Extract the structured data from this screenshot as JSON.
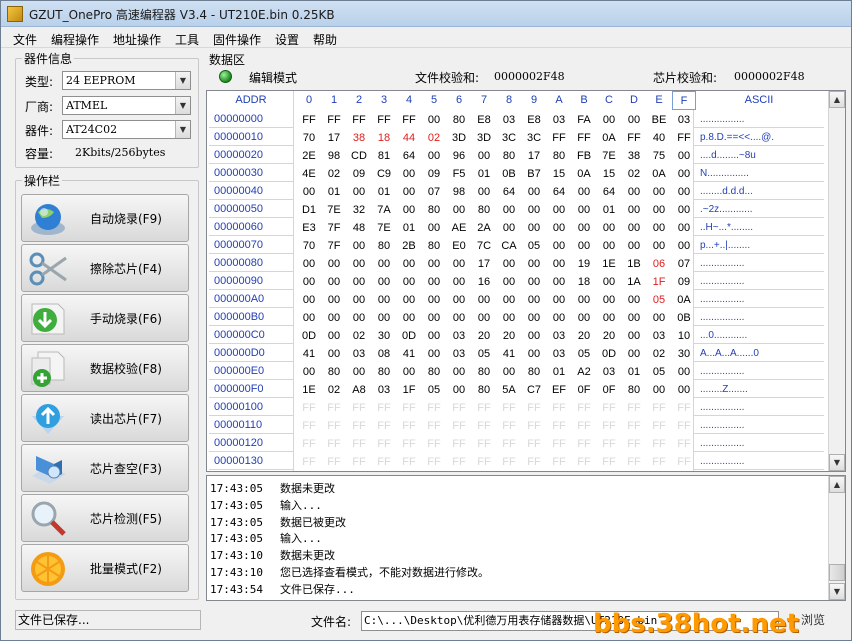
{
  "window": {
    "title": "GZUT_OnePro 高速编程器 V3.4 - UT210E.bin  0.25KB"
  },
  "menu": [
    {
      "label": "文件",
      "name": "menu-file"
    },
    {
      "label": "编程操作",
      "name": "menu-program"
    },
    {
      "label": "地址操作",
      "name": "menu-address"
    },
    {
      "label": "工具",
      "name": "menu-tools"
    },
    {
      "label": "固件操作",
      "name": "menu-firmware"
    },
    {
      "label": "设置",
      "name": "menu-settings"
    },
    {
      "label": "帮助",
      "name": "menu-help"
    }
  ],
  "device": {
    "group_title": "器件信息",
    "type_label": "类型:",
    "type_value": "24 EEPROM",
    "vendor_label": "厂商:",
    "vendor_value": "ATMEL",
    "chip_label": "器件:",
    "chip_value": "AT24C02",
    "capacity_label": "容量:",
    "capacity_value": "2Kbits/256bytes"
  },
  "operations": {
    "group_title": "操作栏",
    "buttons": [
      {
        "label": "自动烧录(F9)",
        "icon": "globe-icon"
      },
      {
        "label": "擦除芯片(F4)",
        "icon": "scissors-icon"
      },
      {
        "label": "手动烧录(F6)",
        "icon": "download-arrow-icon"
      },
      {
        "label": "数据校验(F8)",
        "icon": "verify-plus-icon"
      },
      {
        "label": "读出芯片(F7)",
        "icon": "upload-arrow-icon"
      },
      {
        "label": "芯片查空(F3)",
        "icon": "check-blank-icon"
      },
      {
        "label": "芯片检测(F5)",
        "icon": "magnifier-icon"
      },
      {
        "label": "批量模式(F2)",
        "icon": "orange-icon"
      }
    ]
  },
  "data_area": {
    "title": "数据区",
    "mode": "编辑模式",
    "file_checksum_label": "文件校验和:",
    "file_checksum": "0000002F48",
    "chip_checksum_label": "芯片校验和:",
    "chip_checksum": "0000002F48"
  },
  "hex": {
    "addr_header": "ADDR",
    "col_headers": [
      "0",
      "1",
      "2",
      "3",
      "4",
      "5",
      "6",
      "7",
      "8",
      "9",
      "A",
      "B",
      "C",
      "D",
      "E",
      "F"
    ],
    "ascii_header": "ASCII",
    "highlight_color": "#e02020",
    "rows": [
      {
        "addr": "00000000",
        "bytes": [
          "FF",
          "FF",
          "FF",
          "FF",
          "FF",
          "00",
          "80",
          "E8",
          "03",
          "E8",
          "03",
          "FA",
          "00",
          "00",
          "BE",
          "03"
        ],
        "red": [],
        "ascii": "................"
      },
      {
        "addr": "00000010",
        "bytes": [
          "70",
          "17",
          "38",
          "18",
          "44",
          "02",
          "3D",
          "3D",
          "3C",
          "3C",
          "FF",
          "FF",
          "0A",
          "FF",
          "40",
          "FF"
        ],
        "red": [
          2,
          3,
          4,
          5
        ],
        "ascii": "p.8.D.==<<....@."
      },
      {
        "addr": "00000020",
        "bytes": [
          "2E",
          "98",
          "CD",
          "81",
          "64",
          "00",
          "96",
          "00",
          "80",
          "17",
          "80",
          "FB",
          "7E",
          "38",
          "75",
          "00"
        ],
        "red": [],
        "ascii": "....d........~8u"
      },
      {
        "addr": "00000030",
        "bytes": [
          "4E",
          "02",
          "09",
          "C9",
          "00",
          "09",
          "F5",
          "01",
          "0B",
          "B7",
          "15",
          "0A",
          "15",
          "02",
          "0A",
          "00"
        ],
        "red": [],
        "ascii": "N..............."
      },
      {
        "addr": "00000040",
        "bytes": [
          "00",
          "01",
          "00",
          "01",
          "00",
          "07",
          "98",
          "00",
          "64",
          "00",
          "64",
          "00",
          "64",
          "00",
          "00",
          "00"
        ],
        "red": [],
        "ascii": "........d.d.d..."
      },
      {
        "addr": "00000050",
        "bytes": [
          "D1",
          "7E",
          "32",
          "7A",
          "00",
          "80",
          "00",
          "80",
          "00",
          "00",
          "00",
          "00",
          "01",
          "00",
          "00",
          "00"
        ],
        "red": [],
        "ascii": ".~2z............"
      },
      {
        "addr": "00000060",
        "bytes": [
          "E3",
          "7F",
          "48",
          "7E",
          "01",
          "00",
          "AE",
          "2A",
          "00",
          "00",
          "00",
          "00",
          "00",
          "00",
          "00",
          "00"
        ],
        "red": [],
        "ascii": "..H~...*........"
      },
      {
        "addr": "00000070",
        "bytes": [
          "70",
          "7F",
          "00",
          "80",
          "2B",
          "80",
          "E0",
          "7C",
          "CA",
          "05",
          "00",
          "00",
          "00",
          "00",
          "00",
          "00"
        ],
        "red": [],
        "ascii": "p...+..|........"
      },
      {
        "addr": "00000080",
        "bytes": [
          "00",
          "00",
          "00",
          "00",
          "00",
          "00",
          "00",
          "17",
          "00",
          "00",
          "00",
          "19",
          "1E",
          "1B",
          "06",
          "07"
        ],
        "red": [
          14
        ],
        "ascii": "................"
      },
      {
        "addr": "00000090",
        "bytes": [
          "00",
          "00",
          "00",
          "00",
          "00",
          "00",
          "00",
          "16",
          "00",
          "00",
          "00",
          "18",
          "00",
          "1A",
          "1F",
          "09"
        ],
        "red": [
          14
        ],
        "ascii": "................"
      },
      {
        "addr": "000000A0",
        "bytes": [
          "00",
          "00",
          "00",
          "00",
          "00",
          "00",
          "00",
          "00",
          "00",
          "00",
          "00",
          "00",
          "00",
          "00",
          "05",
          "0A"
        ],
        "red": [
          14
        ],
        "ascii": "................"
      },
      {
        "addr": "000000B0",
        "bytes": [
          "00",
          "00",
          "00",
          "00",
          "00",
          "00",
          "00",
          "00",
          "00",
          "00",
          "00",
          "00",
          "00",
          "00",
          "00",
          "0B"
        ],
        "red": [],
        "ascii": "................"
      },
      {
        "addr": "000000C0",
        "bytes": [
          "0D",
          "00",
          "02",
          "30",
          "0D",
          "00",
          "03",
          "20",
          "20",
          "00",
          "03",
          "20",
          "20",
          "00",
          "03",
          "10"
        ],
        "red": [],
        "ascii": "...0............"
      },
      {
        "addr": "000000D0",
        "bytes": [
          "41",
          "00",
          "03",
          "08",
          "41",
          "00",
          "03",
          "05",
          "41",
          "00",
          "03",
          "05",
          "0D",
          "00",
          "02",
          "30"
        ],
        "red": [],
        "ascii": "A...A...A......0"
      },
      {
        "addr": "000000E0",
        "bytes": [
          "00",
          "80",
          "00",
          "80",
          "00",
          "80",
          "00",
          "80",
          "00",
          "80",
          "01",
          "A2",
          "03",
          "01",
          "05",
          "00"
        ],
        "red": [],
        "ascii": "................"
      },
      {
        "addr": "000000F0",
        "bytes": [
          "1E",
          "02",
          "A8",
          "03",
          "1F",
          "05",
          "00",
          "80",
          "5A",
          "C7",
          "EF",
          "0F",
          "0F",
          "80",
          "00",
          "00"
        ],
        "red": [],
        "ascii": "........Z......."
      },
      {
        "addr": "00000100",
        "bytes": [
          "FF",
          "FF",
          "FF",
          "FF",
          "FF",
          "FF",
          "FF",
          "FF",
          "FF",
          "FF",
          "FF",
          "FF",
          "FF",
          "FF",
          "FF",
          "FF"
        ],
        "red": [],
        "ghost": true,
        "ascii": "................"
      },
      {
        "addr": "00000110",
        "bytes": [
          "FF",
          "FF",
          "FF",
          "FF",
          "FF",
          "FF",
          "FF",
          "FF",
          "FF",
          "FF",
          "FF",
          "FF",
          "FF",
          "FF",
          "FF",
          "FF"
        ],
        "red": [],
        "ghost": true,
        "ascii": "................"
      },
      {
        "addr": "00000120",
        "bytes": [
          "FF",
          "FF",
          "FF",
          "FF",
          "FF",
          "FF",
          "FF",
          "FF",
          "FF",
          "FF",
          "FF",
          "FF",
          "FF",
          "FF",
          "FF",
          "FF"
        ],
        "red": [],
        "ghost": true,
        "ascii": "................"
      },
      {
        "addr": "00000130",
        "bytes": [
          "FF",
          "FF",
          "FF",
          "FF",
          "FF",
          "FF",
          "FF",
          "FF",
          "FF",
          "FF",
          "FF",
          "FF",
          "FF",
          "FF",
          "FF",
          "FF"
        ],
        "red": [],
        "ghost": true,
        "ascii": "................"
      }
    ]
  },
  "log": [
    {
      "time": "17:43:05",
      "msg": "数据未更改"
    },
    {
      "time": "17:43:05",
      "msg": "输入..."
    },
    {
      "time": "17:43:05",
      "msg": "数据已被更改"
    },
    {
      "time": "17:43:05",
      "msg": "输入..."
    },
    {
      "time": "17:43:10",
      "msg": "数据未更改"
    },
    {
      "time": "17:43:10",
      "msg": "您已选择查看模式，不能对数据进行修改。"
    },
    {
      "time": "17:43:54",
      "msg": "文件已保存..."
    }
  ],
  "status": {
    "message": "文件已保存...",
    "filename_label": "文件名:",
    "filename_value": "C:\\...\\Desktop\\优利德万用表存储器数据\\UT210E.bin",
    "browse_label": "浏览"
  },
  "watermark": "bbs.38hot.net"
}
